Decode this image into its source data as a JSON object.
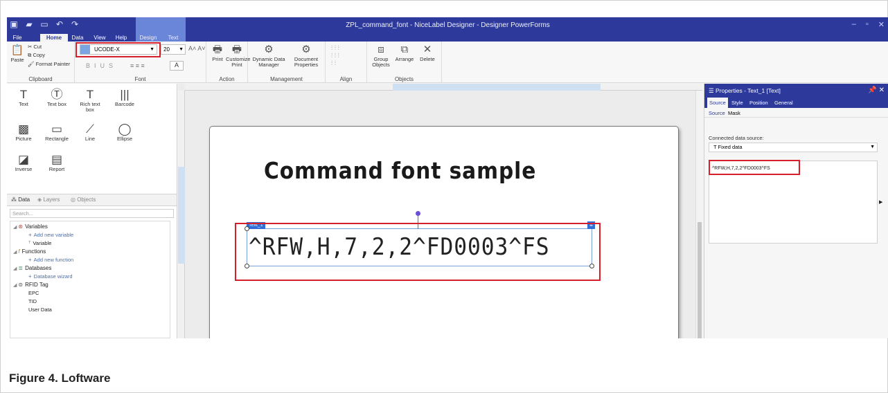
{
  "window": {
    "title": "ZPL_command_font - NiceLabel Designer - Designer PowerForms",
    "controls": [
      "–",
      "▫",
      "✕"
    ]
  },
  "tabs": [
    {
      "label": "File"
    },
    {
      "label": "Home"
    },
    {
      "label": "Data"
    },
    {
      "label": "View"
    },
    {
      "label": "Help"
    },
    {
      "label": "Design"
    },
    {
      "label": "Text"
    }
  ],
  "ribbon": {
    "clipboard": {
      "group": "Clipboard",
      "paste": "Paste",
      "cut": "Cut",
      "copy": "Copy",
      "format_painter": "Format Painter"
    },
    "font": {
      "group": "Font",
      "name": "UCODE-X",
      "size": "20",
      "bold": "B",
      "italic": "I",
      "underline": "U",
      "strike": "S",
      "color": "A"
    },
    "action": {
      "group": "Action",
      "print": "Print",
      "customize_print": "Customize Print"
    },
    "management": {
      "group": "Management",
      "dynamic_data_manager": "Dynamic Data Manager",
      "document_properties": "Document Properties"
    },
    "align": {
      "group": "Align"
    },
    "objects": {
      "group": "Objects",
      "group_objects": "Group Objects",
      "arrange": "Arrange",
      "delete": "Delete"
    }
  },
  "toolbox": [
    {
      "label": "Text",
      "icon": "text-icon"
    },
    {
      "label": "Text box",
      "icon": "textbox-icon"
    },
    {
      "label": "Rich text box",
      "icon": "richtext-icon"
    },
    {
      "label": "Barcode",
      "icon": "barcode-icon"
    },
    {
      "label": "Picture",
      "icon": "picture-icon"
    },
    {
      "label": "Rectangle",
      "icon": "rectangle-icon"
    },
    {
      "label": "Line",
      "icon": "line-icon"
    },
    {
      "label": "Ellipse",
      "icon": "ellipse-icon"
    },
    {
      "label": "Inverse",
      "icon": "inverse-icon"
    },
    {
      "label": "Report",
      "icon": "report-icon"
    }
  ],
  "data_panel": {
    "tabs": [
      "Data",
      "Layers",
      "Objects"
    ],
    "search_placeholder": "Search...",
    "tree": {
      "variables": "Variables",
      "add_variable": "Add new variable",
      "variable": "Variable",
      "functions": "Functions",
      "add_function": "Add new function",
      "databases": "Databases",
      "database_wizard": "Database wizard",
      "rfid": "RFID Tag",
      "epc": "EPC",
      "tid": "TID",
      "user_data": "User Data"
    }
  },
  "canvas": {
    "title_text": "Command font sample",
    "object_name": "Text_1",
    "object_value": "^RFW,H,7,2,2^FD0003^FS"
  },
  "properties": {
    "title": "Properties - Text_1 [Text]",
    "tabs": [
      "Source",
      "Style",
      "Position",
      "General"
    ],
    "subtabs": [
      "Source",
      "Mask"
    ],
    "connected_label": "Connected data source:",
    "data_source": "Fixed data",
    "value": "^RFW,H,7,2,2^FD0003^FS"
  },
  "caption": "Figure 4.  Loftware",
  "colors": {
    "title_bar": "#2d3a9c",
    "highlight_box": "#d61f2b",
    "selection": "#2f6fd6"
  }
}
